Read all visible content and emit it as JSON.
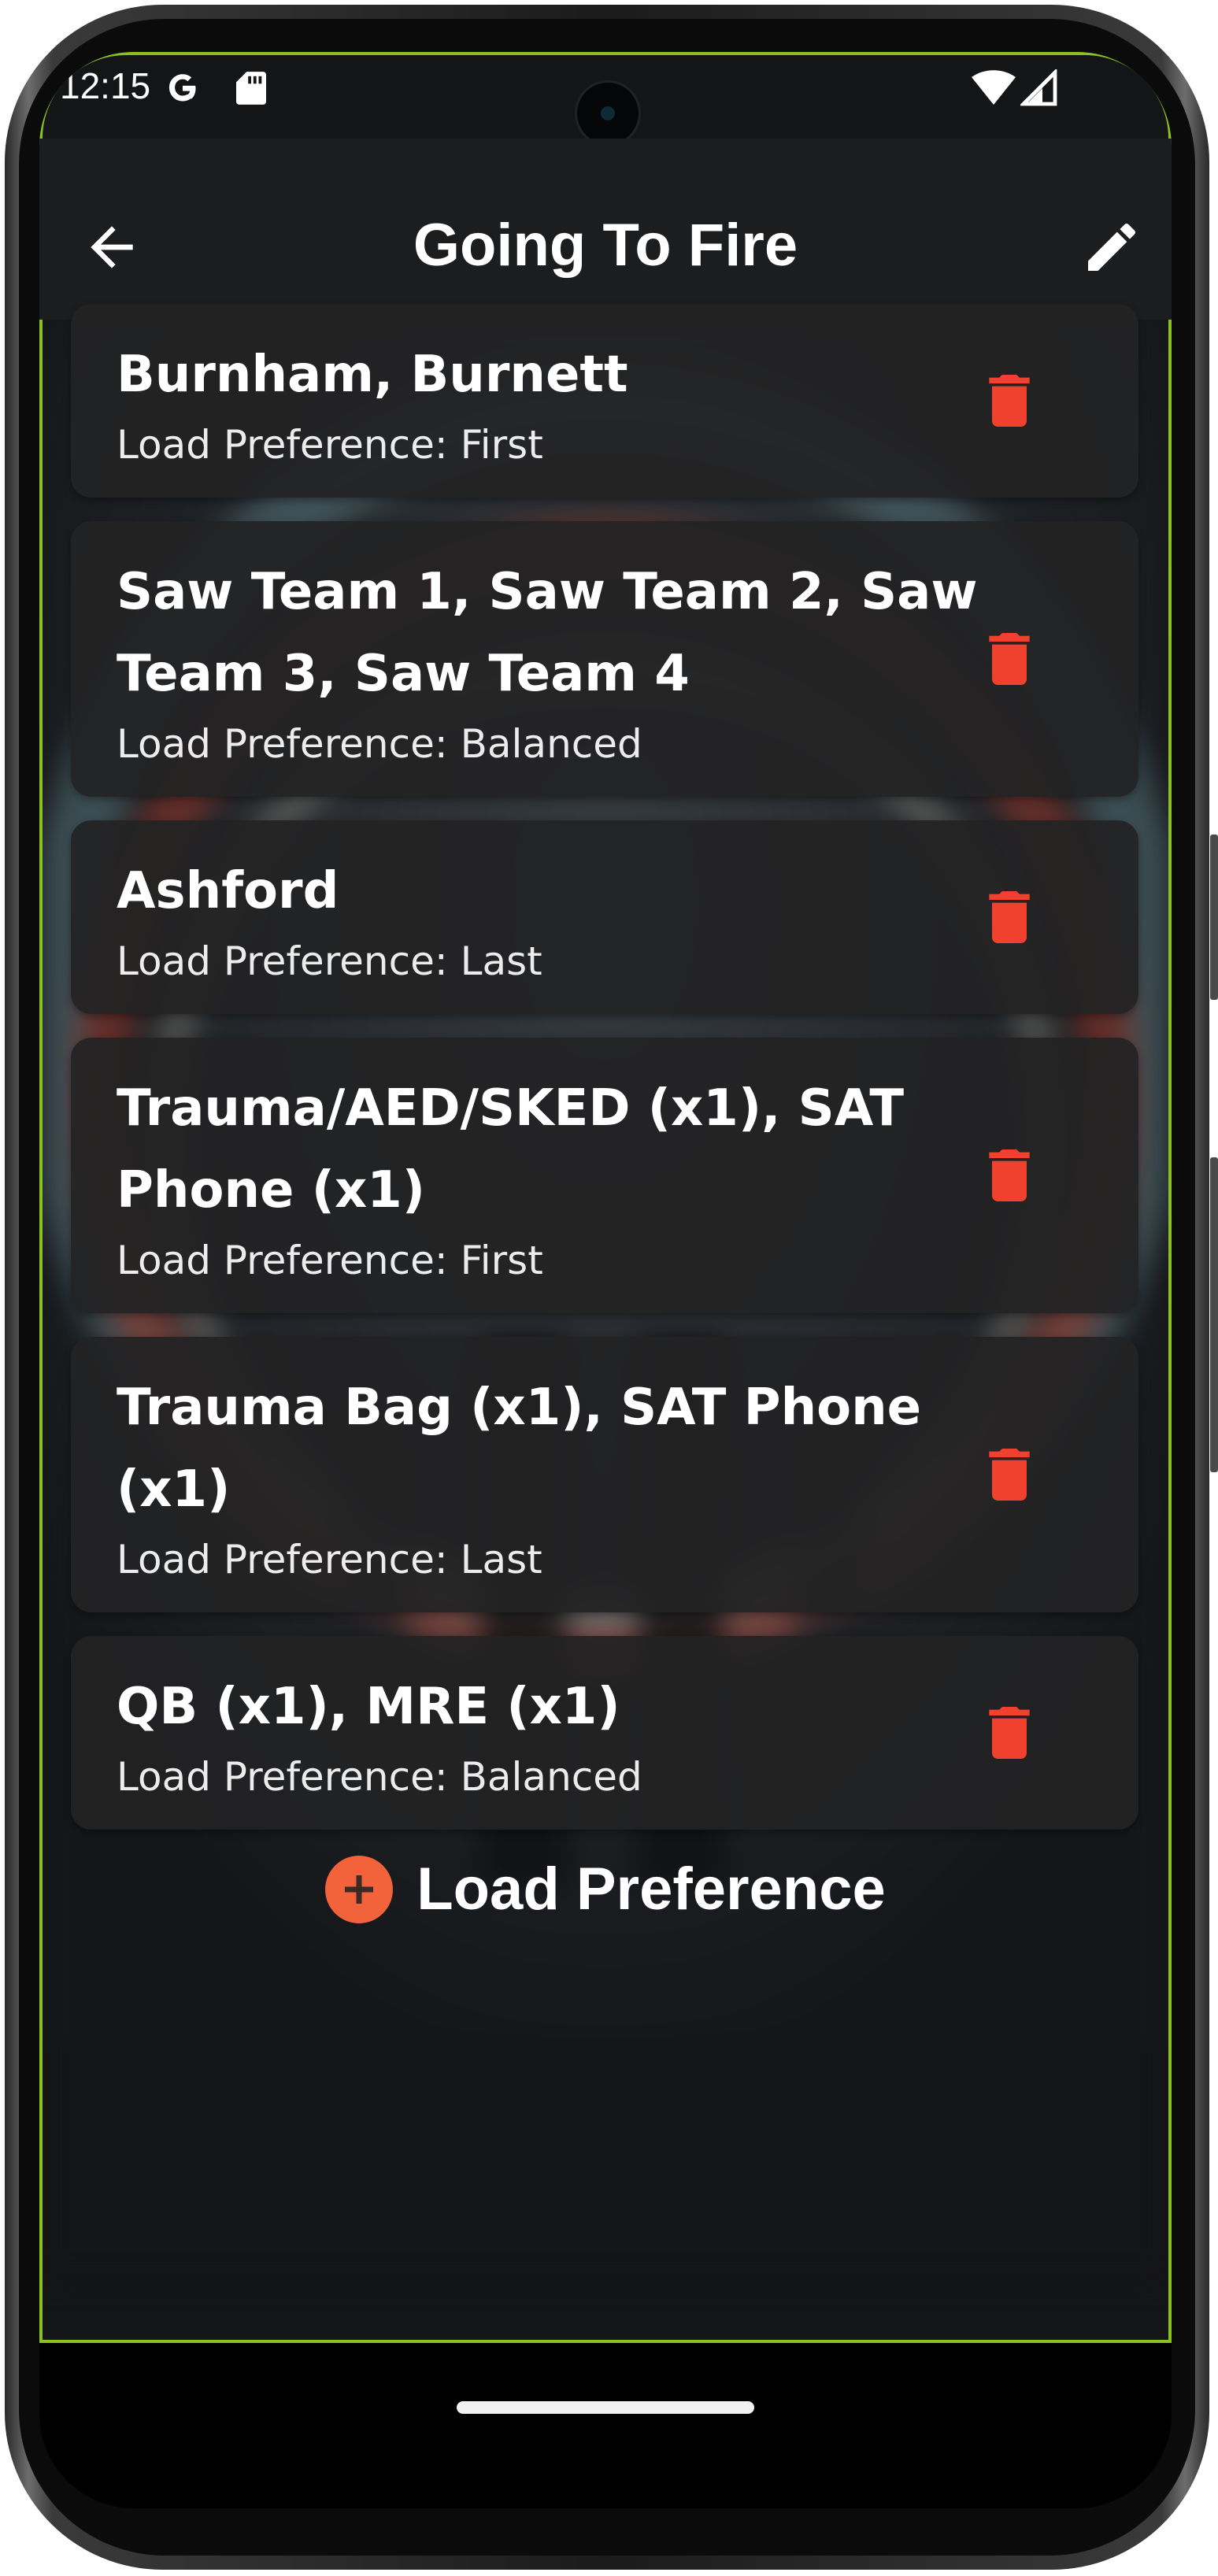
{
  "status_bar": {
    "time": "12:15",
    "icons": [
      "google-g-icon",
      "sd-card-icon",
      "wifi-icon",
      "signal-icon"
    ]
  },
  "app_bar": {
    "title": "Going To Fire",
    "back_icon": "arrow-left-icon",
    "edit_icon": "pencil-icon"
  },
  "preferences": [
    {
      "title": "Burnham, Burnett",
      "subtitle": "Load Preference: First"
    },
    {
      "title": "Saw Team 1, Saw Team 2, Saw Team 3, Saw Team 4",
      "subtitle": "Load Preference: Balanced"
    },
    {
      "title": "Ashford",
      "subtitle": "Load Preference: Last"
    },
    {
      "title": "Trauma/AED/SKED (x1), SAT Phone (x1)",
      "subtitle": "Load Preference: First"
    },
    {
      "title": "Trauma Bag (x1), SAT Phone (x1)",
      "subtitle": "Load Preference: Last"
    },
    {
      "title": "QB (x1), MRE (x1)",
      "subtitle": "Load Preference: Balanced"
    }
  ],
  "delete_icon": "trash-icon",
  "add_button": {
    "label": "Load Preference",
    "icon": "plus-circle-icon"
  },
  "colors": {
    "accent": "#f2633b",
    "delete": "#f0412e",
    "card_bg": "#222224",
    "app_bar_bg": "#1c1d1f",
    "outline": "#8bc11f"
  }
}
